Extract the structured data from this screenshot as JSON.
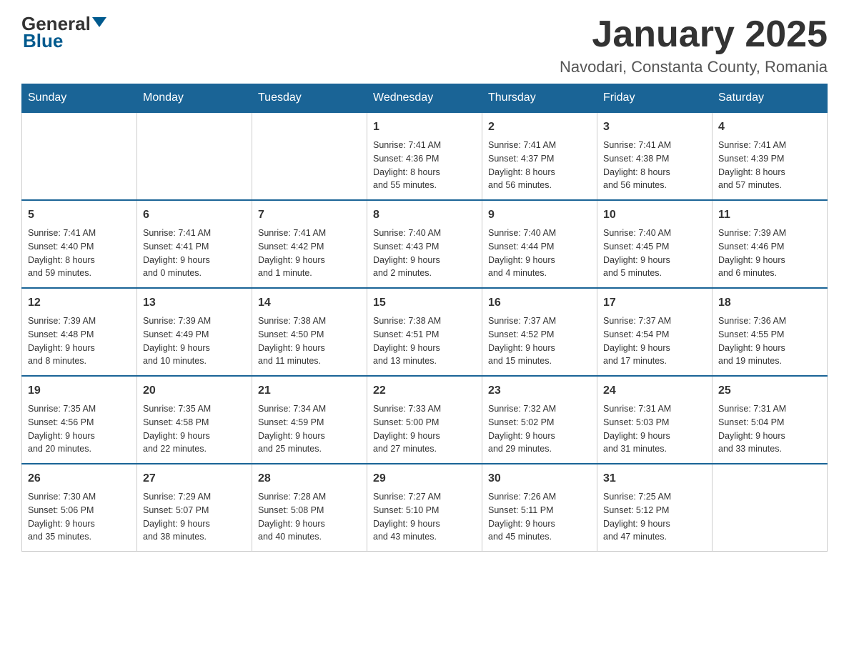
{
  "header": {
    "logo_general": "General",
    "logo_blue": "Blue",
    "month_title": "January 2025",
    "location": "Navodari, Constanta County, Romania"
  },
  "weekdays": [
    "Sunday",
    "Monday",
    "Tuesday",
    "Wednesday",
    "Thursday",
    "Friday",
    "Saturday"
  ],
  "weeks": [
    [
      {
        "day": "",
        "info": ""
      },
      {
        "day": "",
        "info": ""
      },
      {
        "day": "",
        "info": ""
      },
      {
        "day": "1",
        "info": "Sunrise: 7:41 AM\nSunset: 4:36 PM\nDaylight: 8 hours\nand 55 minutes."
      },
      {
        "day": "2",
        "info": "Sunrise: 7:41 AM\nSunset: 4:37 PM\nDaylight: 8 hours\nand 56 minutes."
      },
      {
        "day": "3",
        "info": "Sunrise: 7:41 AM\nSunset: 4:38 PM\nDaylight: 8 hours\nand 56 minutes."
      },
      {
        "day": "4",
        "info": "Sunrise: 7:41 AM\nSunset: 4:39 PM\nDaylight: 8 hours\nand 57 minutes."
      }
    ],
    [
      {
        "day": "5",
        "info": "Sunrise: 7:41 AM\nSunset: 4:40 PM\nDaylight: 8 hours\nand 59 minutes."
      },
      {
        "day": "6",
        "info": "Sunrise: 7:41 AM\nSunset: 4:41 PM\nDaylight: 9 hours\nand 0 minutes."
      },
      {
        "day": "7",
        "info": "Sunrise: 7:41 AM\nSunset: 4:42 PM\nDaylight: 9 hours\nand 1 minute."
      },
      {
        "day": "8",
        "info": "Sunrise: 7:40 AM\nSunset: 4:43 PM\nDaylight: 9 hours\nand 2 minutes."
      },
      {
        "day": "9",
        "info": "Sunrise: 7:40 AM\nSunset: 4:44 PM\nDaylight: 9 hours\nand 4 minutes."
      },
      {
        "day": "10",
        "info": "Sunrise: 7:40 AM\nSunset: 4:45 PM\nDaylight: 9 hours\nand 5 minutes."
      },
      {
        "day": "11",
        "info": "Sunrise: 7:39 AM\nSunset: 4:46 PM\nDaylight: 9 hours\nand 6 minutes."
      }
    ],
    [
      {
        "day": "12",
        "info": "Sunrise: 7:39 AM\nSunset: 4:48 PM\nDaylight: 9 hours\nand 8 minutes."
      },
      {
        "day": "13",
        "info": "Sunrise: 7:39 AM\nSunset: 4:49 PM\nDaylight: 9 hours\nand 10 minutes."
      },
      {
        "day": "14",
        "info": "Sunrise: 7:38 AM\nSunset: 4:50 PM\nDaylight: 9 hours\nand 11 minutes."
      },
      {
        "day": "15",
        "info": "Sunrise: 7:38 AM\nSunset: 4:51 PM\nDaylight: 9 hours\nand 13 minutes."
      },
      {
        "day": "16",
        "info": "Sunrise: 7:37 AM\nSunset: 4:52 PM\nDaylight: 9 hours\nand 15 minutes."
      },
      {
        "day": "17",
        "info": "Sunrise: 7:37 AM\nSunset: 4:54 PM\nDaylight: 9 hours\nand 17 minutes."
      },
      {
        "day": "18",
        "info": "Sunrise: 7:36 AM\nSunset: 4:55 PM\nDaylight: 9 hours\nand 19 minutes."
      }
    ],
    [
      {
        "day": "19",
        "info": "Sunrise: 7:35 AM\nSunset: 4:56 PM\nDaylight: 9 hours\nand 20 minutes."
      },
      {
        "day": "20",
        "info": "Sunrise: 7:35 AM\nSunset: 4:58 PM\nDaylight: 9 hours\nand 22 minutes."
      },
      {
        "day": "21",
        "info": "Sunrise: 7:34 AM\nSunset: 4:59 PM\nDaylight: 9 hours\nand 25 minutes."
      },
      {
        "day": "22",
        "info": "Sunrise: 7:33 AM\nSunset: 5:00 PM\nDaylight: 9 hours\nand 27 minutes."
      },
      {
        "day": "23",
        "info": "Sunrise: 7:32 AM\nSunset: 5:02 PM\nDaylight: 9 hours\nand 29 minutes."
      },
      {
        "day": "24",
        "info": "Sunrise: 7:31 AM\nSunset: 5:03 PM\nDaylight: 9 hours\nand 31 minutes."
      },
      {
        "day": "25",
        "info": "Sunrise: 7:31 AM\nSunset: 5:04 PM\nDaylight: 9 hours\nand 33 minutes."
      }
    ],
    [
      {
        "day": "26",
        "info": "Sunrise: 7:30 AM\nSunset: 5:06 PM\nDaylight: 9 hours\nand 35 minutes."
      },
      {
        "day": "27",
        "info": "Sunrise: 7:29 AM\nSunset: 5:07 PM\nDaylight: 9 hours\nand 38 minutes."
      },
      {
        "day": "28",
        "info": "Sunrise: 7:28 AM\nSunset: 5:08 PM\nDaylight: 9 hours\nand 40 minutes."
      },
      {
        "day": "29",
        "info": "Sunrise: 7:27 AM\nSunset: 5:10 PM\nDaylight: 9 hours\nand 43 minutes."
      },
      {
        "day": "30",
        "info": "Sunrise: 7:26 AM\nSunset: 5:11 PM\nDaylight: 9 hours\nand 45 minutes."
      },
      {
        "day": "31",
        "info": "Sunrise: 7:25 AM\nSunset: 5:12 PM\nDaylight: 9 hours\nand 47 minutes."
      },
      {
        "day": "",
        "info": ""
      }
    ]
  ]
}
